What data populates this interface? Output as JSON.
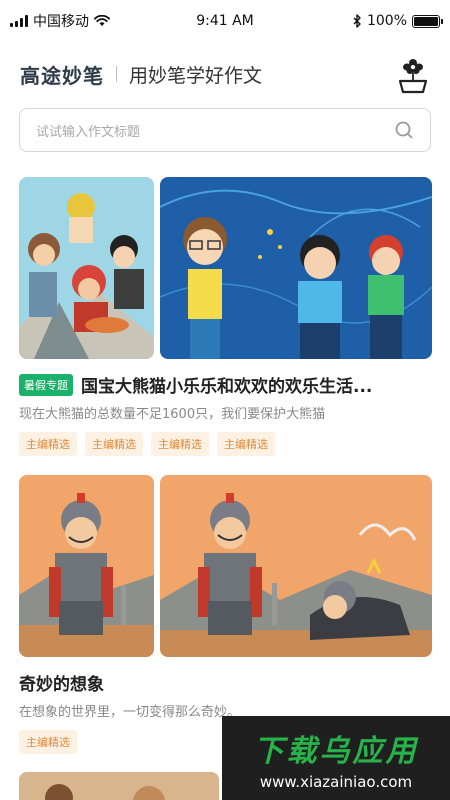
{
  "status": {
    "carrier": "中国移动",
    "time": "9:41 AM",
    "battery": "100%",
    "battery_level": 1.0
  },
  "header": {
    "logo": "高途妙笔",
    "slogan": "用妙笔学好作文",
    "icon": "flower-pot-icon"
  },
  "search": {
    "placeholder": "试试输入作文标题",
    "icon": "search-icon"
  },
  "cards": [
    {
      "special_tag": "暑假专题",
      "title": "国宝大熊猫小乐乐和欢欢的欢乐生活...",
      "desc": "现在大熊猫的总数量不足1600只，我们要保护大熊猫",
      "tags": [
        "主编精选",
        "主编精选",
        "主编精选",
        "主编精选"
      ]
    },
    {
      "title": "奇妙的想象",
      "desc": "在想象的世界里，一切变得那么奇妙。",
      "tags": [
        "主编精选"
      ]
    }
  ],
  "watermark": {
    "title": "下载乌应用",
    "url": "www.xiazainiao.com"
  },
  "colors": {
    "tag_green": "#1ab26b",
    "tag_orange_text": "#e28a3a",
    "tag_orange_bg": "#fdf1e4"
  }
}
